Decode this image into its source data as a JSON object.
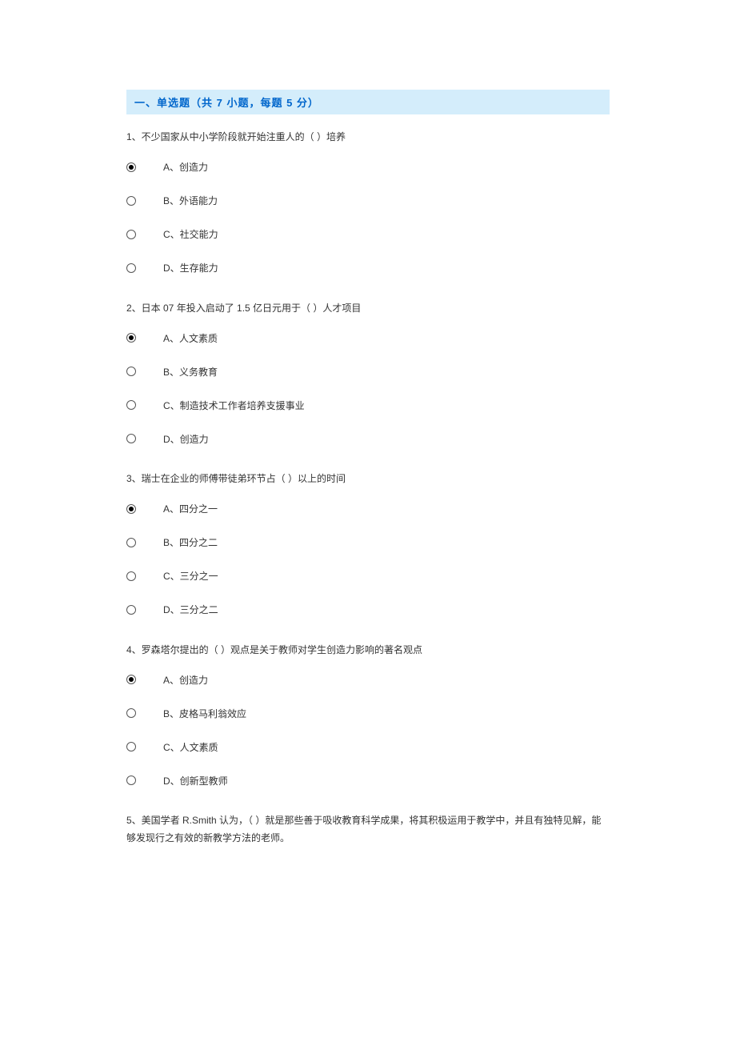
{
  "section_header": "一、单选题（共 7 小题，每题 5 分）",
  "questions": [
    {
      "text": "1、不少国家从中小学阶段就开始注重人的（  ）培养",
      "options": [
        {
          "label": "A、创造力",
          "selected": true
        },
        {
          "label": "B、外语能力",
          "selected": false
        },
        {
          "label": "C、社交能力",
          "selected": false
        },
        {
          "label": "D、生存能力",
          "selected": false
        }
      ]
    },
    {
      "text": "2、日本 07 年投入启动了 1.5 亿日元用于（  ）人才项目",
      "options": [
        {
          "label": "A、人文素质",
          "selected": true
        },
        {
          "label": "B、义务教育",
          "selected": false
        },
        {
          "label": "C、制造技术工作者培养支援事业",
          "selected": false
        },
        {
          "label": "D、创造力",
          "selected": false
        }
      ]
    },
    {
      "text": "3、瑞士在企业的师傅带徒弟环节占（  ）以上的时间",
      "options": [
        {
          "label": "A、四分之一",
          "selected": true
        },
        {
          "label": "B、四分之二",
          "selected": false
        },
        {
          "label": "C、三分之一",
          "selected": false
        },
        {
          "label": "D、三分之二",
          "selected": false
        }
      ]
    },
    {
      "text": "4、罗森塔尔提出的（  ）观点是关于教师对学生创造力影响的著名观点",
      "options": [
        {
          "label": "A、创造力",
          "selected": true
        },
        {
          "label": "B、皮格马利翁效应",
          "selected": false
        },
        {
          "label": "C、人文素质",
          "selected": false
        },
        {
          "label": "D、创新型教师",
          "selected": false
        }
      ]
    },
    {
      "text": "5、美国学者 R.Smith 认为，（  ）就是那些善于吸收教育科学成果，将其积极运用于教学中，并且有独特见解，能够发现行之有效的新教学方法的老师。",
      "options": []
    }
  ]
}
